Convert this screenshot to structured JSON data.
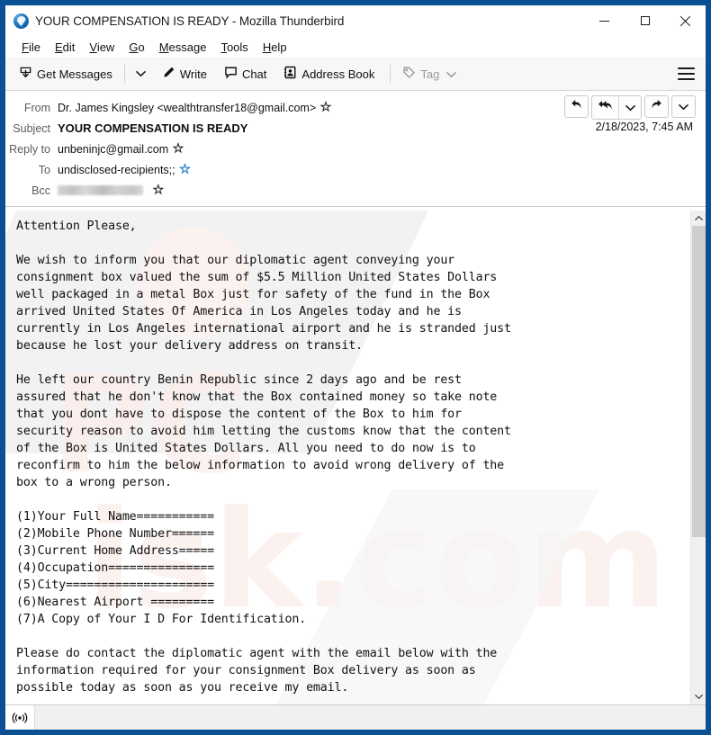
{
  "window": {
    "title": "YOUR COMPENSATION IS READY - Mozilla Thunderbird",
    "logo_icon": "thunderbird-logo",
    "minimize_icon": "minimize-icon",
    "maximize_icon": "maximize-icon",
    "close_icon": "close-icon",
    "frame_color": "#0c5094"
  },
  "menubar": {
    "items": [
      {
        "label": "File",
        "accesskey": "F"
      },
      {
        "label": "Edit",
        "accesskey": "E"
      },
      {
        "label": "View",
        "accesskey": "V"
      },
      {
        "label": "Go",
        "accesskey": "G"
      },
      {
        "label": "Message",
        "accesskey": "M"
      },
      {
        "label": "Tools",
        "accesskey": "T"
      },
      {
        "label": "Help",
        "accesskey": "H"
      }
    ]
  },
  "toolbar": {
    "get_messages_label": "Get Messages",
    "get_messages_icon": "download-inbox-icon",
    "get_messages_caret_icon": "chevron-down-icon",
    "write_label": "Write",
    "write_icon": "pencil-icon",
    "chat_label": "Chat",
    "chat_icon": "chat-bubble-icon",
    "address_book_label": "Address Book",
    "address_book_icon": "address-book-icon",
    "tag_label": "Tag",
    "tag_icon": "tag-icon",
    "tag_caret_icon": "chevron-down-icon",
    "tag_disabled": true,
    "menu_icon": "hamburger-menu-icon"
  },
  "message_header": {
    "rows": [
      {
        "label": "From",
        "value": "Dr. James Kingsley <wealthtransfer18@gmail.com>",
        "star": "black",
        "bold": false,
        "redacted": false
      },
      {
        "label": "Subject",
        "value": "YOUR COMPENSATION IS READY",
        "star": "none",
        "bold": true,
        "redacted": false
      },
      {
        "label": "Reply to",
        "value": "unbeninjc@gmail.com",
        "star": "black",
        "bold": false,
        "redacted": false
      },
      {
        "label": "To",
        "value": "undisclosed-recipients;;",
        "star": "blue",
        "bold": false,
        "redacted": false
      },
      {
        "label": "Bcc",
        "value": "",
        "star": "black",
        "bold": false,
        "redacted": true
      }
    ],
    "date": "2/18/2023, 7:45 AM",
    "actions": [
      {
        "name": "reply-button",
        "icon": "reply-arrow-icon"
      },
      {
        "name": "reply-all-button",
        "icon": "reply-all-arrow-icon"
      },
      {
        "name": "reply-more-button",
        "icon": "chevron-down-icon"
      },
      {
        "name": "forward-button",
        "icon": "forward-arrow-icon"
      },
      {
        "name": "more-actions-button",
        "icon": "chevron-down-icon"
      }
    ]
  },
  "message_body": {
    "text": "Attention Please,\n\nWe wish to inform you that our diplomatic agent conveying your\nconsignment box valued the sum of $5.5 Million United States Dollars\nwell packaged in a metal Box just for safety of the fund in the Box\narrived United States Of America in Los Angeles today and he is\ncurrently in Los Angeles international airport and he is stranded just\nbecause he lost your delivery address on transit.\n\nHe left our country Benin Republic since 2 days ago and be rest\nassured that he don't know that the Box contained money so take note\nthat you dont have to dispose the content of the Box to him for\nsecurity reason to avoid him letting the customs know that the content\nof the Box is United States Dollars. All you need to do now is to\nreconfirm to him the below information to avoid wrong delivery of the\nbox to a wrong person.\n\n(1)Your Full Name===========\n(2)Mobile Phone Number======\n(3)Current Home Address=====\n(4)Occupation===============\n(5)City=====================\n(6)Nearest Airport =========\n(7)A Copy of Your I D For Identification.\n\nPlease do contact the diplomatic agent with the email below with the\ninformation required for your consignment Box delivery as soon as\npossible today as soon as you receive my email."
  },
  "scrollbar": {
    "up_icon": "chevron-up-icon",
    "down_icon": "chevron-down-icon",
    "thumb_position_percent": 0,
    "thumb_size_percent": 63
  },
  "statusbar": {
    "icon": "network-activity-icon",
    "text": ""
  }
}
